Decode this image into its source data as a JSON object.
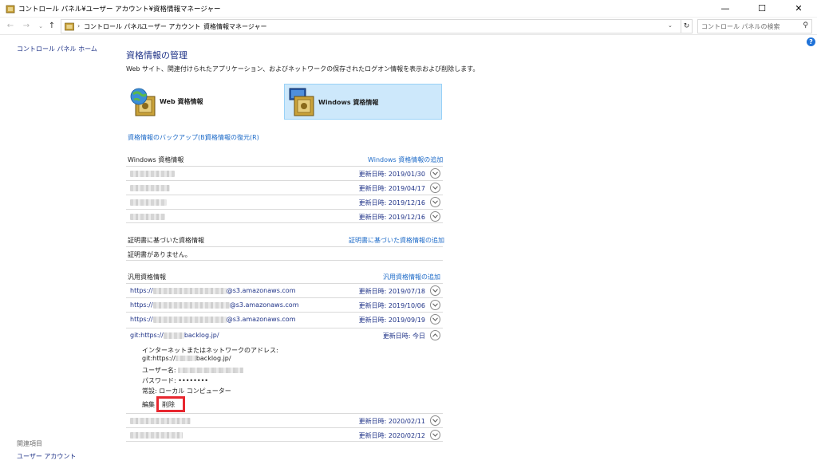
{
  "window": {
    "title": "コントロール パネル¥ユーザー アカウント¥資格情報マネージャー",
    "minimize": "—",
    "maximize": "☐",
    "close": "✕"
  },
  "address": {
    "back": "←",
    "forward": "→",
    "up": "↑",
    "crumbs": [
      "コントロール パネル",
      "ユーザー アカウント",
      "資格情報マネージャー"
    ],
    "separator": "›",
    "refresh": "↻",
    "search_placeholder": "コントロール パネルの検索"
  },
  "help": "?",
  "sidebar": {
    "home": "コントロール パネル ホーム",
    "related_heading": "関連項目",
    "user_accounts": "ユーザー アカウント"
  },
  "main": {
    "title": "資格情報の管理",
    "description": "Web サイト、関連付けられたアプリケーション、およびネットワークの保存されたログオン情報を表示および削除します。",
    "web_button": "Web 資格情報",
    "windows_button": "Windows 資格情報",
    "backup_link": "資格情報のバックアップ(B)",
    "restore_link": "資格情報の復元(R)"
  },
  "windows_section": {
    "heading": "Windows 資格情報",
    "add_link": "Windows 資格情報の追加",
    "items": [
      {
        "date": "更新日時: 2019/01/30"
      },
      {
        "date": "更新日時: 2019/04/17"
      },
      {
        "date": "更新日時: 2019/12/16"
      },
      {
        "date": "更新日時: 2019/12/16"
      }
    ]
  },
  "cert_section": {
    "heading": "証明書に基づいた資格情報",
    "add_link": "証明書に基づいた資格情報の追加",
    "empty": "証明書がありません。"
  },
  "generic_section": {
    "heading": "汎用資格情報",
    "add_link": "汎用資格情報の追加",
    "items": [
      {
        "prefix": "https://",
        "suffix": "@s3.amazonaws.com",
        "date": "更新日時: 2019/07/18"
      },
      {
        "prefix": "https://",
        "suffix": "@s3.amazonaws.com",
        "date": "更新日時: 2019/10/06"
      },
      {
        "prefix": "https://",
        "suffix": "@s3.amazonaws.com",
        "date": "更新日時: 2019/09/19"
      }
    ],
    "expanded": {
      "prefix": "git:https://",
      "suffix": "backlog.jp/",
      "date": "更新日時: 今日",
      "address_label": "インターネットまたはネットワークのアドレス:",
      "address_prefix": "git:https://",
      "address_suffix": "backlog.jp/",
      "username_label": "ユーザー名:",
      "password_label": "パスワード:",
      "password_value": "••••••••",
      "persistence": "常設: ローカル コンピューター",
      "edit": "編集",
      "delete": "削除"
    },
    "after_items": [
      {
        "date": "更新日時: 2020/02/11"
      },
      {
        "date": "更新日時: 2020/02/12"
      }
    ]
  },
  "colors": {
    "link": "#1e6bc8",
    "heading": "#1e3287",
    "selected_tile": "#cde8fb",
    "highlight_box": "#e8272f"
  }
}
